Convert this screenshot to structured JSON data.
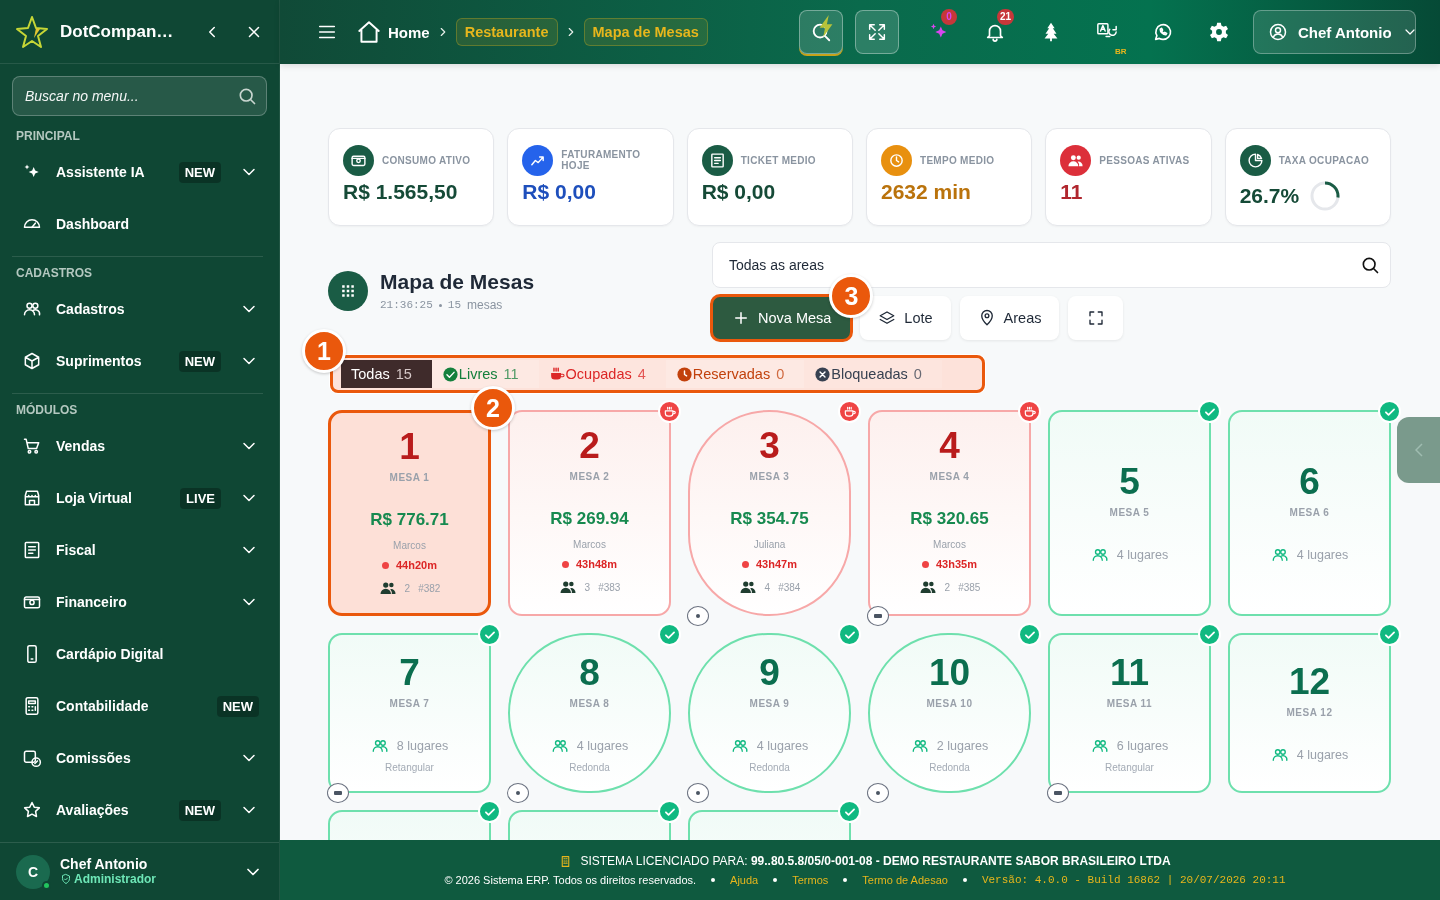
{
  "sidebar": {
    "brand": "DotCompan…",
    "search": {
      "placeholder": "Buscar no menu..."
    },
    "sections": [
      {
        "title": "PRINCIPAL",
        "items": [
          {
            "label": "Assistente IA",
            "badge": "NEW",
            "expandable": true
          },
          {
            "label": "Dashboard",
            "expandable": false
          }
        ]
      },
      {
        "title": "CADASTROS",
        "items": [
          {
            "label": "Cadastros",
            "expandable": true
          },
          {
            "label": "Suprimentos",
            "badge": "NEW",
            "expandable": true
          }
        ]
      },
      {
        "title": "MÓDULOS",
        "items": [
          {
            "label": "Vendas",
            "expandable": true
          },
          {
            "label": "Loja Virtual",
            "badge": "LIVE",
            "expandable": true
          },
          {
            "label": "Fiscal",
            "expandable": true
          },
          {
            "label": "Financeiro",
            "expandable": true
          },
          {
            "label": "Cardápio Digital",
            "expandable": false
          },
          {
            "label": "Contabilidade",
            "badge": "NEW",
            "expandable": false
          },
          {
            "label": "Comissões",
            "expandable": true
          },
          {
            "label": "Avaliações",
            "badge": "NEW",
            "expandable": true
          }
        ]
      }
    ],
    "user": {
      "initial": "C",
      "name": "Chef Antonio",
      "role": "Administrador",
      "online": true
    }
  },
  "topbar": {
    "breadcrumb": [
      {
        "label": "Home",
        "kind": "home"
      },
      {
        "label": "Restaurante",
        "kind": "pill"
      },
      {
        "label": "Mapa de Mesas",
        "kind": "pill"
      }
    ],
    "ai_count": "0",
    "notification_count": "21",
    "language": "BR",
    "user": "Chef Antonio"
  },
  "stats": [
    {
      "label": "CONSUMO ATIVO",
      "value": "R$ 1.565,50",
      "color": "#1a5c45"
    },
    {
      "label": "FATURAMENTO HOJE",
      "value": "R$ 0,00",
      "color": "#2563eb"
    },
    {
      "label": "TICKET MEDIO",
      "value": "R$ 0,00",
      "color": "#1a5c45"
    },
    {
      "label": "TEMPO MEDIO",
      "value": "2632 min",
      "color": "#e8900f"
    },
    {
      "label": "PESSOAS ATIVAS",
      "value": "11",
      "color": "#dc2f3a"
    },
    {
      "label": "TAXA OCUPACAO",
      "value": "26.7%",
      "color": "#1a5c45",
      "level": 0.267
    }
  ],
  "map": {
    "title": "Mapa de Mesas",
    "time": "21:36:25",
    "count": "15",
    "count_label": "mesas",
    "area_filter": {
      "value": "Todas as areas"
    },
    "actions": [
      {
        "label": "Nova Mesa",
        "kind": "primary",
        "tour_step": "3"
      },
      {
        "label": "Lote",
        "kind": "secondary"
      },
      {
        "label": "Areas",
        "kind": "secondary"
      },
      {
        "kind": "icon"
      }
    ],
    "filters_tour_step": "1",
    "filters": [
      {
        "label": "Todas",
        "count": "15",
        "selected": true,
        "kind": "all",
        "color": "#3b2a2a"
      },
      {
        "label": "Livres",
        "count": "11",
        "selected": false,
        "kind": "free",
        "color": "#15803d"
      },
      {
        "label": "Ocupadas",
        "count": "4",
        "selected": false,
        "kind": "occupied",
        "color": "#dc2626"
      },
      {
        "label": "Reservadas",
        "count": "0",
        "selected": false,
        "kind": "reserved",
        "color": "#c2410c"
      },
      {
        "label": "Bloqueadas",
        "count": "0",
        "selected": false,
        "kind": "blocked",
        "color": "#374151"
      }
    ]
  },
  "tables": [
    {
      "number": "1",
      "name": "MESA 1",
      "kind": "occupied",
      "round": false,
      "marker": false,
      "selected": true,
      "tour_step": "2",
      "amount": "R$ 776.71",
      "waiter": "Marcos",
      "elapsed": "44h20m",
      "guests": "2",
      "order": "#382"
    },
    {
      "number": "2",
      "name": "MESA 2",
      "kind": "occupied",
      "round": false,
      "marker": false,
      "selected": false,
      "amount": "R$ 269.94",
      "waiter": "Marcos",
      "elapsed": "43h48m",
      "guests": "3",
      "order": "#383"
    },
    {
      "number": "3",
      "name": "MESA 3",
      "kind": "occupied",
      "round": true,
      "marker": true,
      "selected": false,
      "amount": "R$ 354.75",
      "waiter": "Juliana",
      "elapsed": "43h47m",
      "guests": "4",
      "order": "#384"
    },
    {
      "number": "4",
      "name": "MESA 4",
      "kind": "occupied",
      "round": false,
      "marker": true,
      "selected": false,
      "amount": "R$ 320.65",
      "waiter": "Marcos",
      "elapsed": "43h35m",
      "guests": "2",
      "order": "#385"
    },
    {
      "number": "5",
      "name": "MESA 5",
      "kind": "free",
      "round": false,
      "marker": false,
      "selected": false,
      "seats": "4 lugares"
    },
    {
      "number": "6",
      "name": "MESA 6",
      "kind": "free",
      "round": false,
      "marker": false,
      "selected": false,
      "seats": "4 lugares"
    },
    {
      "number": "7",
      "name": "MESA 7",
      "kind": "free",
      "round": false,
      "marker": true,
      "selected": false,
      "seats": "8 lugares",
      "shape_label": "Retangular"
    },
    {
      "number": "8",
      "name": "MESA 8",
      "kind": "free",
      "round": true,
      "marker": true,
      "selected": false,
      "seats": "4 lugares",
      "shape_label": "Redonda"
    },
    {
      "number": "9",
      "name": "MESA 9",
      "kind": "free",
      "round": true,
      "marker": true,
      "selected": false,
      "seats": "4 lugares",
      "shape_label": "Redonda"
    },
    {
      "number": "10",
      "name": "MESA 10",
      "kind": "free",
      "round": true,
      "marker": true,
      "selected": false,
      "seats": "2 lugares",
      "shape_label": "Redonda"
    },
    {
      "number": "11",
      "name": "MESA 11",
      "kind": "free",
      "round": false,
      "marker": true,
      "selected": false,
      "seats": "6 lugares",
      "shape_label": "Retangular"
    },
    {
      "number": "12",
      "name": "MESA 12",
      "kind": "free",
      "round": false,
      "marker": false,
      "selected": false,
      "seats": "4 lugares"
    },
    {
      "kind": "free",
      "round": false,
      "selected": false
    },
    {
      "kind": "free",
      "round": false,
      "selected": false
    },
    {
      "kind": "free",
      "round": false,
      "selected": false
    }
  ],
  "footer": {
    "license": "SISTEMA LICENCIADO PARA: **99..80.5.8/05/0-001-08 - DEMO RESTAURANTE SABOR BRASILEIRO LTDA**",
    "copyright": "© 2026 Sistema ERP. Todos os direitos reservados.",
    "links": [
      "Ajuda",
      "Termos",
      "Termo de Adesao"
    ],
    "version": "Versão: 4.0.0 - Build 16862 | 20/07/2026 20:11"
  }
}
